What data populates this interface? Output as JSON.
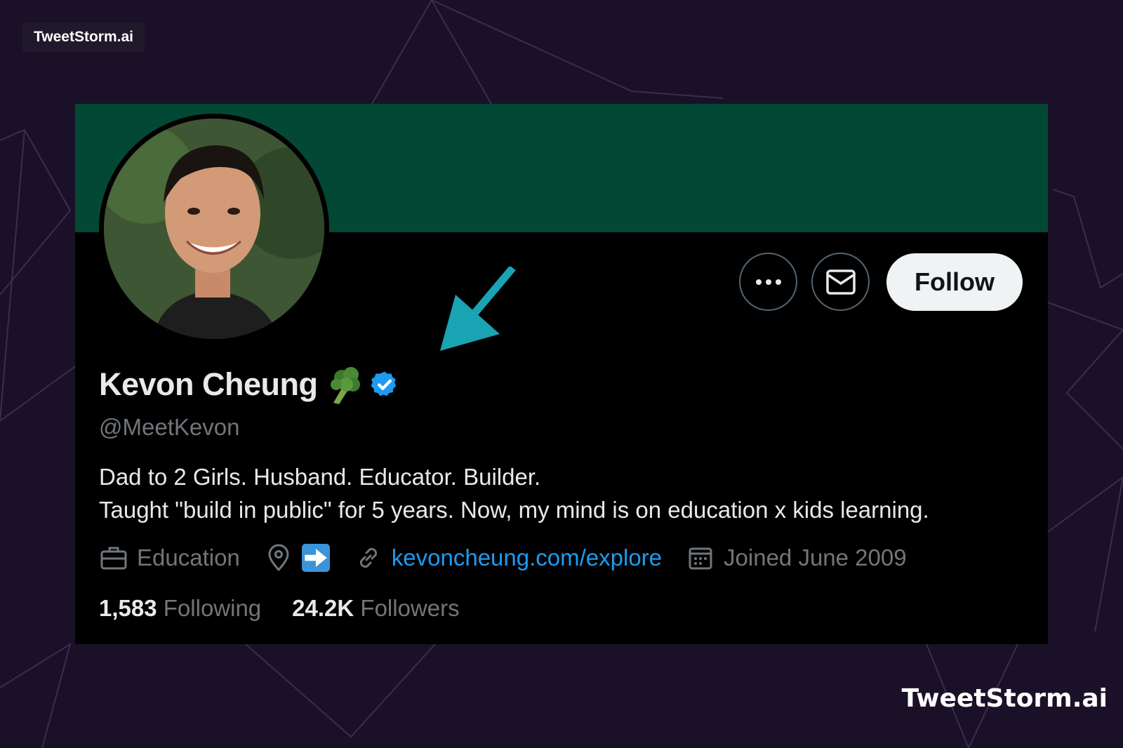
{
  "brand": {
    "badge_text": "TweetStorm.ai",
    "watermark_text": "TweetStorm.ai"
  },
  "colors": {
    "page_bg": "#1a1128",
    "banner": "#024834",
    "card_bg": "#000000",
    "link": "#1d9bf0",
    "verified": "#1d9bf0",
    "annotation_arrow": "#1aa3b3",
    "muted_text": "#71767b"
  },
  "profile": {
    "display_name": "Kevon Cheung",
    "name_emoji": "broccoli-icon",
    "verified_badge": "verified-badge-icon",
    "handle": "@MeetKevon",
    "bio_line1": "Dad to 2 Girls. Husband. Educator. Builder.",
    "bio_line2": "Taught \"build in public\" for 5 years. Now, my mind is on education x kids learning.",
    "category": "Education",
    "location_icon": "location-pin-icon",
    "location_emoji": "right-arrow-emoji-icon",
    "website": "kevoncheung.com/explore",
    "joined": "Joined June 2009",
    "following_count": "1,583",
    "following_label": "Following",
    "followers_count": "24.2K",
    "followers_label": "Followers"
  },
  "actions": {
    "more_icon": "more-dots-icon",
    "message_icon": "mail-icon",
    "follow_label": "Follow"
  }
}
